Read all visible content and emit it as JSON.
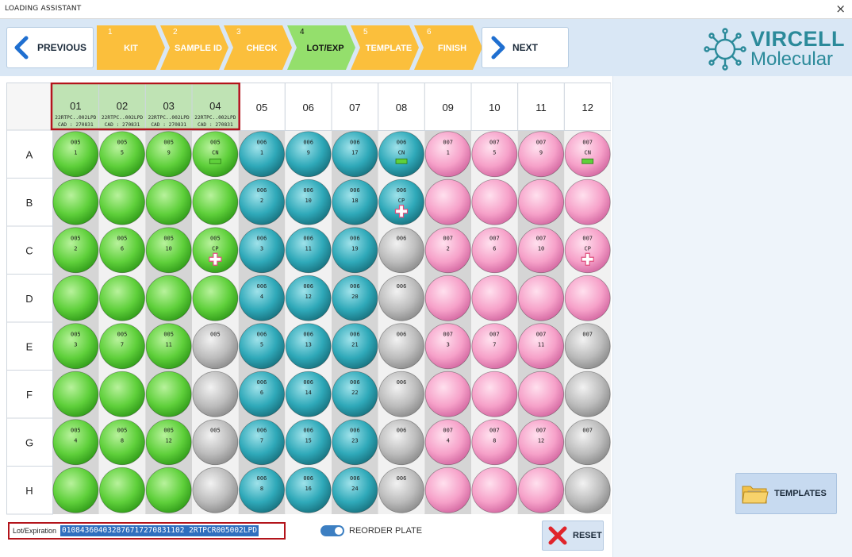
{
  "window": {
    "title": "LOADING ASSISTANT",
    "close_glyph": "×"
  },
  "nav": {
    "previous_label": "PREVIOUS",
    "next_label": "NEXT",
    "steps": [
      {
        "num": "1",
        "label": "KIT",
        "state": "done"
      },
      {
        "num": "2",
        "label": "SAMPLE ID",
        "state": "done"
      },
      {
        "num": "3",
        "label": "CHECK",
        "state": "done"
      },
      {
        "num": "4",
        "label": "LOT/EXP",
        "state": "active"
      },
      {
        "num": "5",
        "label": "TEMPLATE",
        "state": "pending"
      },
      {
        "num": "6",
        "label": "FINISH",
        "state": "pending"
      }
    ]
  },
  "logo": {
    "brand": "VIRCELL",
    "sub": "Molecular"
  },
  "plate": {
    "columns": [
      {
        "label": "01",
        "lot": "22RTPC..002LPD",
        "cad": "CAD : 270831"
      },
      {
        "label": "02",
        "lot": "22RTPC..002LPD",
        "cad": "CAD : 270831"
      },
      {
        "label": "03",
        "lot": "22RTPC..002LPD",
        "cad": "CAD : 270831"
      },
      {
        "label": "04",
        "lot": "22RTPC..002LPD",
        "cad": "CAD : 270831"
      },
      {
        "label": "05"
      },
      {
        "label": "06"
      },
      {
        "label": "07"
      },
      {
        "label": "08"
      },
      {
        "label": "09"
      },
      {
        "label": "10"
      },
      {
        "label": "11"
      },
      {
        "label": "12"
      }
    ],
    "rows": [
      "A",
      "B",
      "C",
      "D",
      "E",
      "F",
      "G",
      "H"
    ],
    "colors": {
      "green": "#5fd03b",
      "teal": "#2fa9b9",
      "pink": "#f6a1c9",
      "gray": "#b9b9b9"
    },
    "wells": {
      "A": [
        {
          "c": "green",
          "l1": "005",
          "l2": "1"
        },
        {
          "c": "green",
          "l1": "005",
          "l2": "5"
        },
        {
          "c": "green",
          "l1": "005",
          "l2": "9"
        },
        {
          "c": "green",
          "l1": "005",
          "l2": "CN",
          "m": "minus"
        },
        {
          "c": "teal",
          "l1": "006",
          "l2": "1"
        },
        {
          "c": "teal",
          "l1": "006",
          "l2": "9"
        },
        {
          "c": "teal",
          "l1": "006",
          "l2": "17"
        },
        {
          "c": "teal",
          "l1": "006",
          "l2": "CN",
          "m": "minus"
        },
        {
          "c": "pink",
          "l1": "007",
          "l2": "1"
        },
        {
          "c": "pink",
          "l1": "007",
          "l2": "5"
        },
        {
          "c": "pink",
          "l1": "007",
          "l2": "9"
        },
        {
          "c": "pink",
          "l1": "007",
          "l2": "CN",
          "m": "minus"
        }
      ],
      "B": [
        {
          "c": "green"
        },
        {
          "c": "green"
        },
        {
          "c": "green"
        },
        {
          "c": "green"
        },
        {
          "c": "teal",
          "l1": "006",
          "l2": "2"
        },
        {
          "c": "teal",
          "l1": "006",
          "l2": "10"
        },
        {
          "c": "teal",
          "l1": "006",
          "l2": "18"
        },
        {
          "c": "teal",
          "l1": "006",
          "l2": "CP",
          "m": "plus"
        },
        {
          "c": "pink"
        },
        {
          "c": "pink"
        },
        {
          "c": "pink"
        },
        {
          "c": "pink"
        }
      ],
      "C": [
        {
          "c": "green",
          "l1": "005",
          "l2": "2"
        },
        {
          "c": "green",
          "l1": "005",
          "l2": "6"
        },
        {
          "c": "green",
          "l1": "005",
          "l2": "10"
        },
        {
          "c": "green",
          "l1": "005",
          "l2": "CP",
          "m": "plus"
        },
        {
          "c": "teal",
          "l1": "006",
          "l2": "3"
        },
        {
          "c": "teal",
          "l1": "006",
          "l2": "11"
        },
        {
          "c": "teal",
          "l1": "006",
          "l2": "19"
        },
        {
          "c": "gray",
          "l1": "006"
        },
        {
          "c": "pink",
          "l1": "007",
          "l2": "2"
        },
        {
          "c": "pink",
          "l1": "007",
          "l2": "6"
        },
        {
          "c": "pink",
          "l1": "007",
          "l2": "10"
        },
        {
          "c": "pink",
          "l1": "007",
          "l2": "CP",
          "m": "plus"
        }
      ],
      "D": [
        {
          "c": "green"
        },
        {
          "c": "green"
        },
        {
          "c": "green"
        },
        {
          "c": "green"
        },
        {
          "c": "teal",
          "l1": "006",
          "l2": "4"
        },
        {
          "c": "teal",
          "l1": "006",
          "l2": "12"
        },
        {
          "c": "teal",
          "l1": "006",
          "l2": "20"
        },
        {
          "c": "gray",
          "l1": "006"
        },
        {
          "c": "pink"
        },
        {
          "c": "pink"
        },
        {
          "c": "pink"
        },
        {
          "c": "pink"
        }
      ],
      "E": [
        {
          "c": "green",
          "l1": "005",
          "l2": "3"
        },
        {
          "c": "green",
          "l1": "005",
          "l2": "7"
        },
        {
          "c": "green",
          "l1": "005",
          "l2": "11"
        },
        {
          "c": "gray",
          "l1": "005"
        },
        {
          "c": "teal",
          "l1": "006",
          "l2": "5"
        },
        {
          "c": "teal",
          "l1": "006",
          "l2": "13"
        },
        {
          "c": "teal",
          "l1": "006",
          "l2": "21"
        },
        {
          "c": "gray",
          "l1": "006"
        },
        {
          "c": "pink",
          "l1": "007",
          "l2": "3"
        },
        {
          "c": "pink",
          "l1": "007",
          "l2": "7"
        },
        {
          "c": "pink",
          "l1": "007",
          "l2": "11"
        },
        {
          "c": "gray",
          "l1": "007"
        }
      ],
      "F": [
        {
          "c": "green"
        },
        {
          "c": "green"
        },
        {
          "c": "green"
        },
        {
          "c": "gray"
        },
        {
          "c": "teal",
          "l1": "006",
          "l2": "6"
        },
        {
          "c": "teal",
          "l1": "006",
          "l2": "14"
        },
        {
          "c": "teal",
          "l1": "006",
          "l2": "22"
        },
        {
          "c": "gray",
          "l1": "006"
        },
        {
          "c": "pink"
        },
        {
          "c": "pink"
        },
        {
          "c": "pink"
        },
        {
          "c": "gray"
        }
      ],
      "G": [
        {
          "c": "green",
          "l1": "005",
          "l2": "4"
        },
        {
          "c": "green",
          "l1": "005",
          "l2": "8"
        },
        {
          "c": "green",
          "l1": "005",
          "l2": "12"
        },
        {
          "c": "gray",
          "l1": "005"
        },
        {
          "c": "teal",
          "l1": "006",
          "l2": "7"
        },
        {
          "c": "teal",
          "l1": "006",
          "l2": "15"
        },
        {
          "c": "teal",
          "l1": "006",
          "l2": "23"
        },
        {
          "c": "gray",
          "l1": "006"
        },
        {
          "c": "pink",
          "l1": "007",
          "l2": "4"
        },
        {
          "c": "pink",
          "l1": "007",
          "l2": "8"
        },
        {
          "c": "pink",
          "l1": "007",
          "l2": "12"
        },
        {
          "c": "gray",
          "l1": "007"
        }
      ],
      "H": [
        {
          "c": "green"
        },
        {
          "c": "green"
        },
        {
          "c": "green"
        },
        {
          "c": "gray"
        },
        {
          "c": "teal",
          "l1": "006",
          "l2": "8"
        },
        {
          "c": "teal",
          "l1": "006",
          "l2": "16"
        },
        {
          "c": "teal",
          "l1": "006",
          "l2": "24"
        },
        {
          "c": "gray",
          "l1": "006"
        },
        {
          "c": "pink"
        },
        {
          "c": "pink"
        },
        {
          "c": "pink"
        },
        {
          "c": "gray"
        }
      ]
    }
  },
  "lot_expiration": {
    "label": "Lot/Expiration",
    "value": "010843604032876717270831102 2RTPCR005002LPD"
  },
  "reorder": {
    "label": "REORDER PLATE",
    "on": true
  },
  "reset": {
    "label": "RESET"
  },
  "templates": {
    "label": "TEMPLATES"
  },
  "icons": {
    "previous": "chevron-left-icon",
    "next": "chevron-right-icon",
    "reset": "red-x-icon",
    "templates": "folder-icon",
    "logo": "virus-logo-icon",
    "close": "close-icon"
  }
}
